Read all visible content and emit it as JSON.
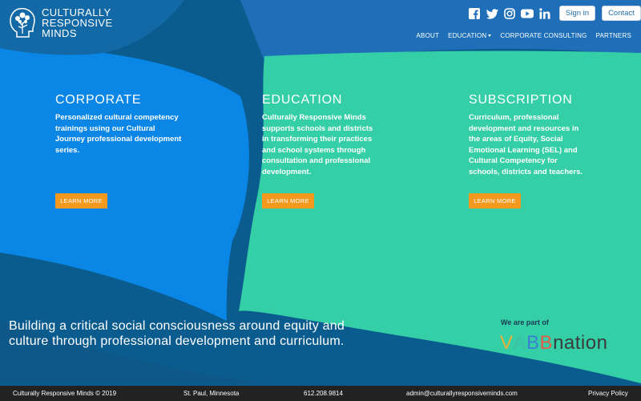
{
  "brand": {
    "line1": "CULTURALLY",
    "line2": "RESPONSIVE",
    "line3": "MINDS"
  },
  "social": {
    "icons": [
      "facebook-icon",
      "twitter-icon",
      "instagram-icon",
      "youtube-icon",
      "linkedin-icon"
    ]
  },
  "auth": {
    "sign_in": "Sign in",
    "contact": "Contact"
  },
  "nav": {
    "about": "ABOUT",
    "education": "EDUCATION",
    "corporate": "CORPORATE CONSULTING",
    "partners": "PARTNERS"
  },
  "columns": [
    {
      "title": "CORPORATE",
      "body": "Personalized cultural competency trainings using our Cultural Journey professional development series.",
      "cta": "LEARN MORE"
    },
    {
      "title": "EDUCATION",
      "body": "Culturally Responsive Minds supports schools and districts in transforming their practices and school systems through consultation and professional development.",
      "cta": "LEARN MORE"
    },
    {
      "title": "SUBSCRIPTION",
      "body": "Curriculum, professional development and resources in the areas of Equity, Social Emotional Learning (SEL) and Cultural Competency for schools, districts and teachers.",
      "cta": "LEARN MORE"
    }
  ],
  "tagline": "Building a critical social consciousness around equity and culture through professional development and curriculum.",
  "partner": {
    "label": "We are part of",
    "logo_text": "VABBnation",
    "logo_colors": [
      "#e8b13b",
      "#3fbfa8",
      "#3d7fd0",
      "#e25c4a",
      "#3a3a3a"
    ]
  },
  "footer": {
    "copyright": "Culturally Responsive Minds © 2019",
    "location": "St. Paul, Minnesota",
    "phone": "612.208.9814",
    "email": "admin@culturallyresponsiveminds.com",
    "privacy": "Privacy Policy"
  },
  "colors": {
    "deep_blue": "#0b5c8e",
    "bright_blue": "#0a86e6",
    "top_blue": "#1e6fb8",
    "teal": "#34cfa6",
    "orange": "#f39a1e",
    "footer": "#222222"
  }
}
